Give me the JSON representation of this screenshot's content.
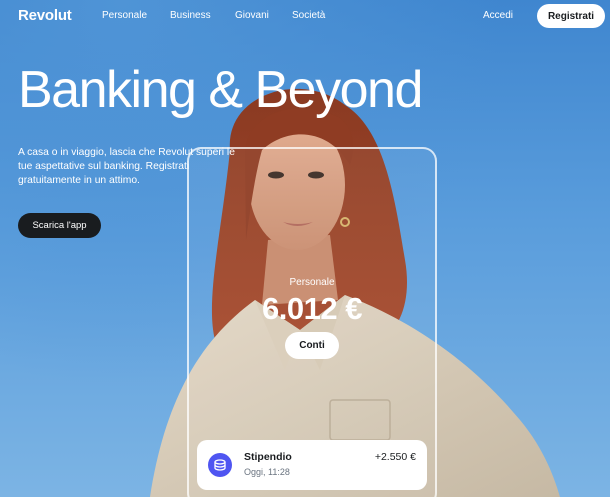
{
  "nav": {
    "logo": "Revolut",
    "links": [
      "Personale",
      "Business",
      "Giovani",
      "Società"
    ],
    "login": "Accedi",
    "signup": "Registrati"
  },
  "hero": {
    "headline": "Banking & Beyond",
    "subtitle": "A casa o in viaggio, lascia che Revolut superi le tue aspettative sul banking. Registrati gratuitamente in un attimo.",
    "cta": "Scarica l'app"
  },
  "phone": {
    "account_label": "Personale",
    "balance": "6.012 €",
    "button": "Conti",
    "transaction": {
      "icon": "coins-icon",
      "title": "Stipendio",
      "time": "Oggi, 11:28",
      "amount": "+2.550 €"
    }
  },
  "colors": {
    "sky": "#4a8fd4",
    "dark": "#191c1f",
    "accent": "#4f55f1",
    "white": "#ffffff"
  }
}
